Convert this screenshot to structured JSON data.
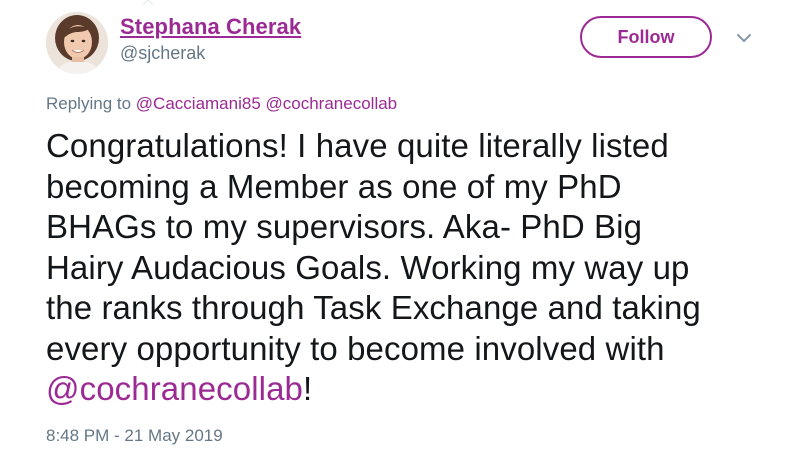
{
  "user": {
    "name": "Stephana Cherak",
    "handle": "@sjcherak"
  },
  "follow_label": "Follow",
  "reply": {
    "prefix": "Replying to",
    "mentions": [
      "@Cacciamani85",
      "@cochranecollab"
    ]
  },
  "tweet": {
    "lines": [
      "Congratulations! I have quite literally listed",
      "becoming a Member as one of my PhD",
      "BHAGs to my supervisors. Aka- PhD Big",
      "Hairy Audacious Goals. Working my way up",
      "the ranks through Task Exchange and taking",
      "every opportunity to become involved with"
    ],
    "final_mention": "@cochranecollab",
    "final_suffix": "!"
  },
  "timestamp": "8:48 PM - 21 May 2019",
  "colors": {
    "accent": "#9c2a94",
    "text": "#14171a",
    "muted": "#657786"
  },
  "icons": {
    "more": "chevron-down-icon",
    "avatar": "user-avatar-photo"
  }
}
